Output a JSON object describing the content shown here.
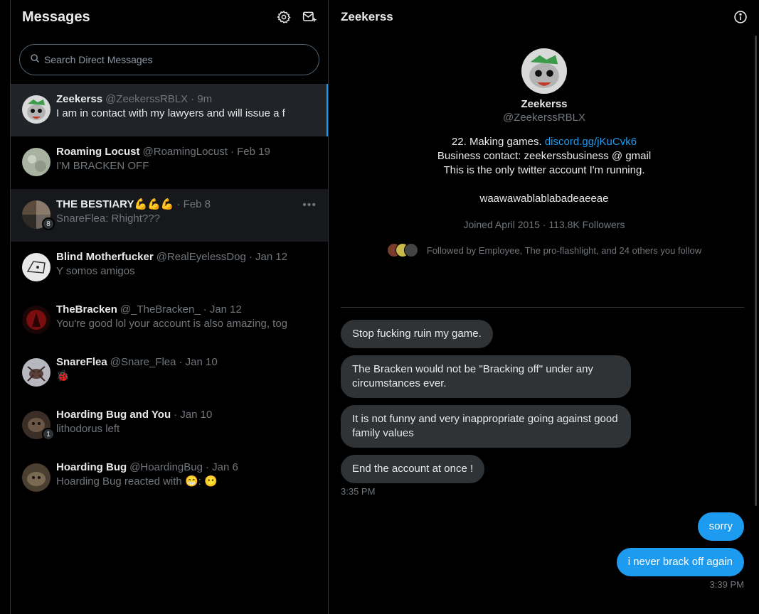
{
  "left": {
    "title": "Messages",
    "search_placeholder": "Search Direct Messages",
    "conversations": [
      {
        "name": "Zeekerss",
        "handle": "@ZeekerssRBLX",
        "time": "· 9m",
        "preview": "I am in contact with my lawyers and will issue a f",
        "badge": ""
      },
      {
        "name": "Roaming Locust",
        "handle": "@RoamingLocust",
        "time": "· Feb 19",
        "preview": "I'M BRACKEN OFF",
        "badge": ""
      },
      {
        "name": "THE BESTIARY💪💪💪",
        "handle": "",
        "time": "· Feb 8",
        "preview": "SnareFlea: Rhight???",
        "badge": "8"
      },
      {
        "name": "Blind Motherfucker",
        "handle": "@RealEyelessDog",
        "time": "· Jan 12",
        "preview": "Y somos amigos",
        "badge": ""
      },
      {
        "name": "TheBracken",
        "handle": "@_TheBracken_",
        "time": "· Jan 12",
        "preview": "You're good lol your account is also amazing, tog",
        "badge": ""
      },
      {
        "name": "SnareFlea",
        "handle": "@Snare_Flea",
        "time": "· Jan 10",
        "preview": "🐞",
        "badge": ""
      },
      {
        "name": "Hoarding Bug and You",
        "handle": "",
        "time": "· Jan 10",
        "preview": "lithodorus left",
        "badge": "1"
      },
      {
        "name": "Hoarding Bug",
        "handle": "@HoardingBug",
        "time": "· Jan 6",
        "preview": "Hoarding Bug reacted with 😁: 😶",
        "badge": ""
      }
    ]
  },
  "right": {
    "title": "Zeekerss",
    "profile": {
      "name": "Zeekerss",
      "handle": "@ZeekerssRBLX",
      "bio_line1_text": "22. Making games. ",
      "bio_line1_link": "discord.gg/jKuCvk6",
      "bio_line2": "Business contact: zeekerssbusiness @ gmail",
      "bio_line3": "This is the only twitter account I'm running.",
      "bio_line4": "waawawablablabadeaeeae",
      "meta": "Joined April 2015 · 113.8K Followers",
      "followed_by": "Followed by Employee, The pro-flashlight, and 24 others you follow"
    },
    "messages": [
      {
        "dir": "in",
        "text": "Stop fucking ruin my game."
      },
      {
        "dir": "in",
        "text": "The Bracken would not be \"Bracking off\" under any circumstances ever."
      },
      {
        "dir": "in",
        "text": "It is not funny and very inappropriate going against good family values"
      },
      {
        "dir": "in",
        "text": "End the account at once !"
      }
    ],
    "time_in": "3:35 PM",
    "replies": [
      {
        "dir": "out",
        "text": "sorry"
      },
      {
        "dir": "out",
        "text": "i never brack off again"
      }
    ],
    "time_out": "3:39 PM"
  },
  "colors": {
    "accent": "#1d9bf0",
    "bubble_in": "#2f3336",
    "bg": "#000000"
  }
}
